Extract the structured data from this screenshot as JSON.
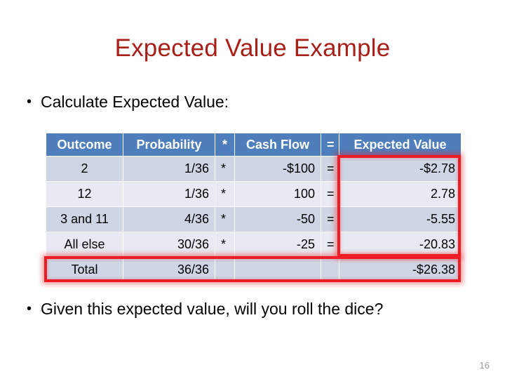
{
  "slide": {
    "title": "Expected Value Example",
    "title_color": "#a81f17",
    "slide_number": "16",
    "bullet_marker": "•",
    "bullets": [
      {
        "text": "Calculate Expected Value:"
      },
      {
        "text": "Given this expected value, will you roll the dice?"
      }
    ]
  },
  "table": {
    "header_bg": "#4e7ebc",
    "header_text_color": "#ffffff",
    "row_dark_bg": "#ced5e4",
    "row_light_bg": "#e7eaf3",
    "columns": [
      "Outcome",
      "Probability",
      "*",
      "Cash Flow",
      "=",
      "Expected Value"
    ],
    "rows": [
      {
        "outcome": "2",
        "probability": "1/36",
        "star": "*",
        "cash_flow": "-$100",
        "equals": "=",
        "expected_value": "-$2.78"
      },
      {
        "outcome": "12",
        "probability": "1/36",
        "star": "*",
        "cash_flow": "100",
        "equals": "=",
        "expected_value": "2.78"
      },
      {
        "outcome": "3 and 11",
        "probability": "4/36",
        "star": "*",
        "cash_flow": "-50",
        "equals": "=",
        "expected_value": "-5.55"
      },
      {
        "outcome": "All else",
        "probability": "30/36",
        "star": "*",
        "cash_flow": "-25",
        "equals": "=",
        "expected_value": "-20.83"
      },
      {
        "outcome": "Total",
        "probability": "36/36",
        "star": "",
        "cash_flow": "",
        "equals": "",
        "expected_value": "-$26.38"
      }
    ]
  },
  "highlights": {
    "color": "#ee1c24",
    "expected_value_column_label": "expected-value-column-highlight",
    "total_row_label": "total-row-highlight"
  }
}
